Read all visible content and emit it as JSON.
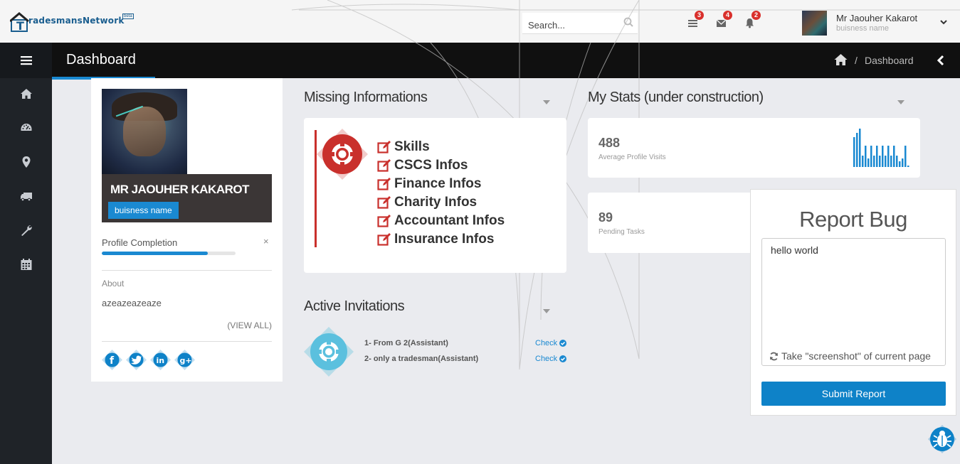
{
  "header": {
    "logo_text": "radesmansNetwork",
    "logo_badge": "beta",
    "search_placeholder": "Search...",
    "notifications": [
      {
        "icon": "tasks-icon",
        "count": "3"
      },
      {
        "icon": "envelope-icon",
        "count": "4"
      },
      {
        "icon": "bell-icon",
        "count": "2"
      }
    ],
    "user_name": "Mr Jaouher Kakarot",
    "user_business": "buisness name"
  },
  "sidebar": {
    "items": [
      {
        "icon": "home-icon"
      },
      {
        "icon": "dashboard-gauge-icon"
      },
      {
        "icon": "map-marker-icon"
      },
      {
        "icon": "truck-icon"
      },
      {
        "icon": "wrench-icon"
      },
      {
        "icon": "calendar-icon"
      }
    ]
  },
  "page": {
    "title": "Dashboard",
    "breadcrumb_separator": "/",
    "breadcrumb_current": "Dashboard"
  },
  "profile": {
    "name": "MR JAOUHER KAKAROT",
    "business": "buisness name",
    "completion_label": "Profile Completion",
    "completion_close": "×",
    "completion_fraction": 0.79,
    "about_label": "About",
    "about_text": "azeazeazeaze",
    "view_all": "(VIEW ALL)",
    "socials": [
      "facebook-icon",
      "twitter-icon",
      "linkedin-icon",
      "google-plus-icon"
    ]
  },
  "missing": {
    "title": "Missing Informations",
    "items": [
      "Skills",
      "CSCS Infos",
      "Finance Infos",
      "Charity Infos",
      "Accountant Infos",
      "Insurance Infos"
    ]
  },
  "invitations": {
    "title": "Active Invitations",
    "items": [
      {
        "text": "1- From G 2(Assistant)",
        "action": "Check"
      },
      {
        "text": "2- only a tradesman(Assistant)",
        "action": "Check"
      }
    ]
  },
  "stats": {
    "title": "My Stats (under construction)",
    "cards": [
      {
        "value": "488",
        "label": "Average Profile Visits"
      },
      {
        "value": "89",
        "label": "Pending Tasks"
      }
    ]
  },
  "report": {
    "title": "Report Bug",
    "textarea_value": "hello world",
    "screenshot_label": "Take \"screenshot\" of current page",
    "submit_label": "Submit Report"
  },
  "colors": {
    "accent": "#1a89d1",
    "danger": "#c9302c",
    "sidebar": "#1f2328"
  }
}
